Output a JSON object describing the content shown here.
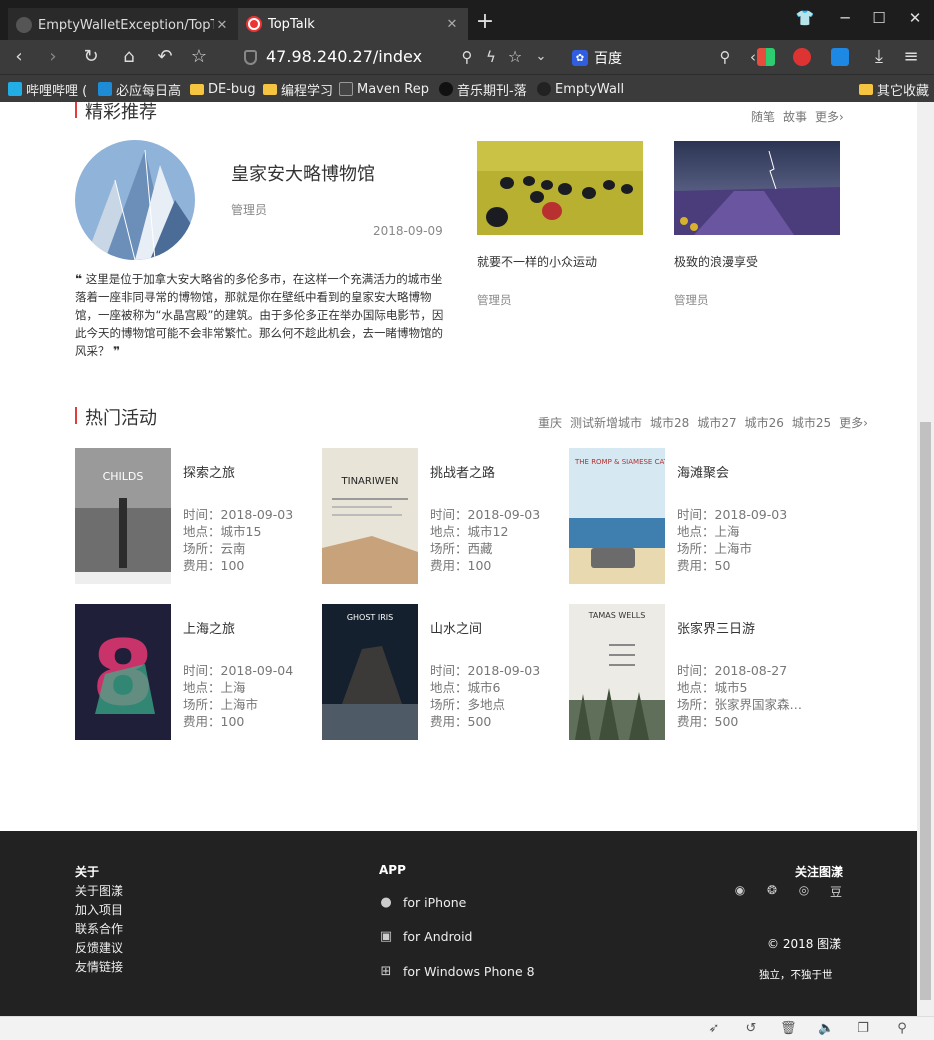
{
  "browser": {
    "tabs": [
      {
        "title": "EmptyWalletException/TopTal",
        "close": "✕"
      },
      {
        "title": "TopTalk",
        "close": "✕"
      }
    ],
    "new_tab": "+",
    "url": "47.98.240.27/index",
    "search_engine": "百度",
    "bookmarks": [
      "哔哩哔哩 (",
      "必应每日高",
      "DE-bug",
      "编程学习",
      "Maven Rep",
      "音乐期刊-落",
      "EmptyWall",
      "其它收藏"
    ]
  },
  "featured": {
    "section_title": "精彩推荐",
    "links": [
      "随笔",
      "故事",
      "更多›"
    ],
    "main": {
      "title": "皇家安大略博物馆",
      "author": "管理员",
      "date": "2018-09-09",
      "quote_open": "❝",
      "quote_close": "❞",
      "excerpt": "这里是位于加拿大安大略省的多伦多市，在这样一个充满活力的城市坐落着一座非同寻常的博物馆，那就是你在壁纸中看到的皇家安大略博物馆，一座被称为“水晶宫殿”的建筑。由于多伦多正在举办国际电影节，因此今天的博物馆可能不会非常繁忙。那么何不趁此机会，去一睹博物馆的风采？"
    },
    "cards": [
      {
        "title": "就要不一样的小众运动",
        "author": "管理员"
      },
      {
        "title": "极致的浪漫享受",
        "author": "管理员"
      }
    ]
  },
  "events": {
    "section_title": "热门活动",
    "links": [
      "重庆",
      "测试新增城市",
      "城市28",
      "城市27",
      "城市26",
      "城市25",
      "更多›"
    ],
    "labels": {
      "time": "时间：",
      "place": "地点：",
      "venue": "场所：",
      "fee": "费用："
    },
    "items": [
      {
        "name": "探索之旅",
        "time": "2018-09-03",
        "place": "城市15",
        "venue": "云南",
        "fee": "100",
        "poster_text": "CHILDS"
      },
      {
        "name": "挑战者之路",
        "time": "2018-09-03",
        "place": "城市12",
        "venue": "西藏",
        "fee": "100",
        "poster_text": "TINARIWEN"
      },
      {
        "name": "海滩聚会",
        "time": "2018-09-03",
        "place": "上海",
        "venue": "上海市",
        "fee": "50",
        "poster_text": "THE ROMP & SIAMESE CATS"
      },
      {
        "name": "上海之旅",
        "time": "2018-09-04",
        "place": "上海",
        "venue": "上海市",
        "fee": "100",
        "poster_text": "8"
      },
      {
        "name": "山水之间",
        "time": "2018-09-03",
        "place": "城市6",
        "venue": "多地点",
        "fee": "500",
        "poster_text": "GHOST IRIS"
      },
      {
        "name": "张家界三日游",
        "time": "2018-08-27",
        "place": "城市5",
        "venue": "张家界国家森林…",
        "fee": "500",
        "poster_text": "TAMAS WELLS"
      }
    ]
  },
  "footer": {
    "about_title": "关于",
    "about_links": [
      "关于图漾",
      "加入项目",
      "联系合作",
      "反馈建议",
      "友情链接"
    ],
    "app_title": "APP",
    "apps": [
      "for iPhone",
      "for Android",
      "for Windows Phone 8"
    ],
    "follow_title": "关注图漾",
    "social_icons": [
      "qq-icon",
      "wechat-icon",
      "weibo-icon",
      "douban-icon"
    ],
    "douban_glyph": "豆",
    "copyright": "© 2018 图漾",
    "slogan": "独立，不独于世"
  }
}
